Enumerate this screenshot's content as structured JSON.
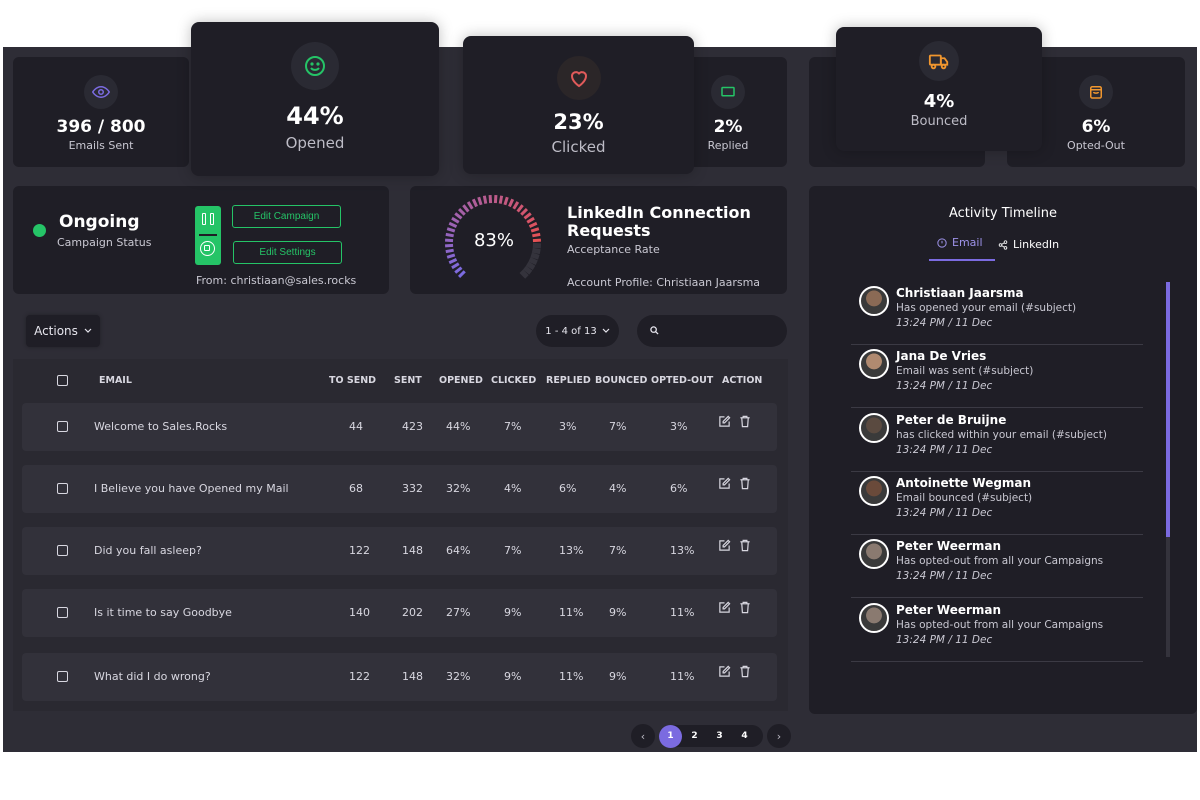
{
  "stats": {
    "emails_sent": {
      "value": "396 / 800",
      "label": "Emails Sent",
      "icon": "eye-icon",
      "color": "#7b6be0"
    },
    "opened": {
      "value": "44%",
      "label": "Opened",
      "icon": "smile-icon",
      "color": "#25c467"
    },
    "clicked": {
      "value": "23%",
      "label": "Clicked",
      "icon": "heart-icon",
      "color": "#e05a5a"
    },
    "replied": {
      "value": "2%",
      "label": "Replied",
      "icon": "message-icon",
      "color": "#25c467"
    },
    "bounced": {
      "value": "4%",
      "label": "Bounced",
      "icon": "truck-icon",
      "color": "#f0962e"
    },
    "opted_out": {
      "value": "6%",
      "label": "Opted-Out",
      "icon": "bag-icon",
      "color": "#f0962e"
    }
  },
  "campaign": {
    "status": "Ongoing",
    "status_label": "Campaign Status",
    "status_color": "#25c467",
    "edit_campaign": "Edit Campaign",
    "edit_settings": "Edit Settings",
    "from": "From: christiaan@sales.rocks"
  },
  "linkedin": {
    "rate": "83%",
    "rate_value": 0.83,
    "title": "LinkedIn Connection Requests",
    "subtitle": "Acceptance Rate",
    "account": "Account Profile: Christiaan Jaarsma"
  },
  "toolbar": {
    "actions_label": "Actions",
    "page_range": "1 - 4 of 13",
    "search_placeholder": ""
  },
  "table": {
    "columns": [
      "EMAIL",
      "TO SEND",
      "SENT",
      "OPENED",
      "CLICKED",
      "REPLIED",
      "BOUNCED",
      "OPTED-OUT",
      "ACTION"
    ],
    "rows": [
      {
        "email": "Welcome to Sales.Rocks",
        "to_send": "44",
        "sent": "423",
        "opened": "44%",
        "clicked": "7%",
        "replied": "3%",
        "bounced": "7%",
        "opted_out": "3%"
      },
      {
        "email": "I Believe you have Opened my Mail",
        "to_send": "68",
        "sent": "332",
        "opened": "32%",
        "clicked": "4%",
        "replied": "6%",
        "bounced": "4%",
        "opted_out": "6%"
      },
      {
        "email": "Did you fall asleep?",
        "to_send": "122",
        "sent": "148",
        "opened": "64%",
        "clicked": "7%",
        "replied": "13%",
        "bounced": "7%",
        "opted_out": "13%"
      },
      {
        "email": "Is it time to say Goodbye",
        "to_send": "140",
        "sent": "202",
        "opened": "27%",
        "clicked": "9%",
        "replied": "11%",
        "bounced": "9%",
        "opted_out": "11%"
      },
      {
        "email": "What did I do wrong?",
        "to_send": "122",
        "sent": "148",
        "opened": "32%",
        "clicked": "9%",
        "replied": "11%",
        "bounced": "9%",
        "opted_out": "11%"
      }
    ]
  },
  "pagination": {
    "pages": [
      "1",
      "2",
      "3",
      "4"
    ],
    "current": "1",
    "prev": "‹",
    "next": "›"
  },
  "timeline": {
    "title": "Activity Timeline",
    "tabs": [
      {
        "label": "Email",
        "active": true
      },
      {
        "label": "LinkedIn",
        "active": false
      }
    ],
    "accent": "#7b6be0",
    "items": [
      {
        "name": "Christiaan Jaarsma",
        "desc": "Has opened your email (#subject)",
        "time": "13:24 PM / 11 Dec"
      },
      {
        "name": "Jana De Vries",
        "desc": "Email was sent (#subject)",
        "time": "13:24 PM / 11 Dec"
      },
      {
        "name": "Peter de Bruijne",
        "desc": "has clicked within your email (#subject)",
        "time": "13:24 PM / 11 Dec"
      },
      {
        "name": "Antoinette Wegman",
        "desc": "Email bounced (#subject)",
        "time": "13:24 PM / 11 Dec"
      },
      {
        "name": "Peter Weerman",
        "desc": "Has opted-out from all your Campaigns",
        "time": "13:24 PM / 11 Dec"
      },
      {
        "name": "Peter Weerman",
        "desc": "Has opted-out from all your Campaigns",
        "time": "13:24 PM / 11 Dec"
      }
    ]
  }
}
